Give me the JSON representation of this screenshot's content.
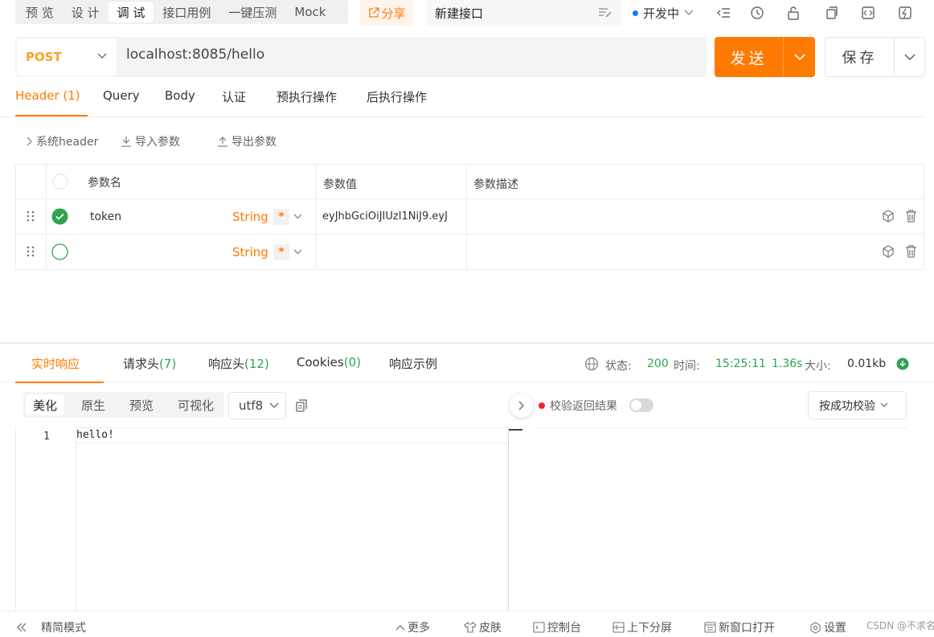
{
  "top": {
    "mode_tabs": [
      "预 览",
      "设 计",
      "调 试",
      "接口用例",
      "一键压测",
      "Mock"
    ],
    "share_label": "分享",
    "tab_name": "新建接口",
    "env_label": "开发中"
  },
  "request": {
    "method": "POST",
    "url": "localhost:8085/hello",
    "send_label": "发送",
    "save_label": "保存"
  },
  "req_tabs": {
    "header_label": "Header",
    "header_count": "(1)",
    "items": [
      "Query",
      "Body",
      "认证",
      "预执行操作",
      "后执行操作"
    ]
  },
  "toolbar": {
    "system_header": "系统header",
    "import_label": "导入参数",
    "export_label": "导出参数"
  },
  "table": {
    "headers": [
      "参数名",
      "参数值",
      "参数描述"
    ],
    "rows": [
      {
        "name": "token",
        "type": "String",
        "required": "*",
        "value": "eyJhbGciOiJIUzI1NiJ9.eyJ",
        "description": "",
        "checked": true
      },
      {
        "name": "",
        "type": "String",
        "required": "*",
        "value": "",
        "description": "",
        "checked": false
      }
    ]
  },
  "response": {
    "tabs": {
      "realtime": "实时响应",
      "req_headers": "请求头",
      "req_headers_count": "(7)",
      "resp_headers": "响应头",
      "resp_headers_count": "(12)",
      "cookies": "Cookies",
      "cookies_count": "(0)",
      "example": "响应示例"
    },
    "status_label": "状态:",
    "status_value": "200",
    "time_label": "时间:",
    "time_value": "15:25:11",
    "duration": "1.36s",
    "size_label": "大小:",
    "size_value": "0.01kb",
    "format_tabs": [
      "美化",
      "原生",
      "预览",
      "可视化"
    ],
    "encoding": "utf8",
    "line_number": "1",
    "body": "hello!",
    "verify_label": "校验返回结果",
    "verify_mode": "按成功校验"
  },
  "statusbar": {
    "simple_mode": "精简模式",
    "more": "更多",
    "skin": "皮肤",
    "console": "控制台",
    "split": "上下分屏",
    "new_window": "新窗口打开",
    "settings": "设置",
    "watermark": "CSDN @不求名"
  },
  "colors": {
    "accent": "#ff7a00",
    "method": "#f5a623",
    "success": "#2ea44f",
    "env_dot": "#1677ff"
  }
}
